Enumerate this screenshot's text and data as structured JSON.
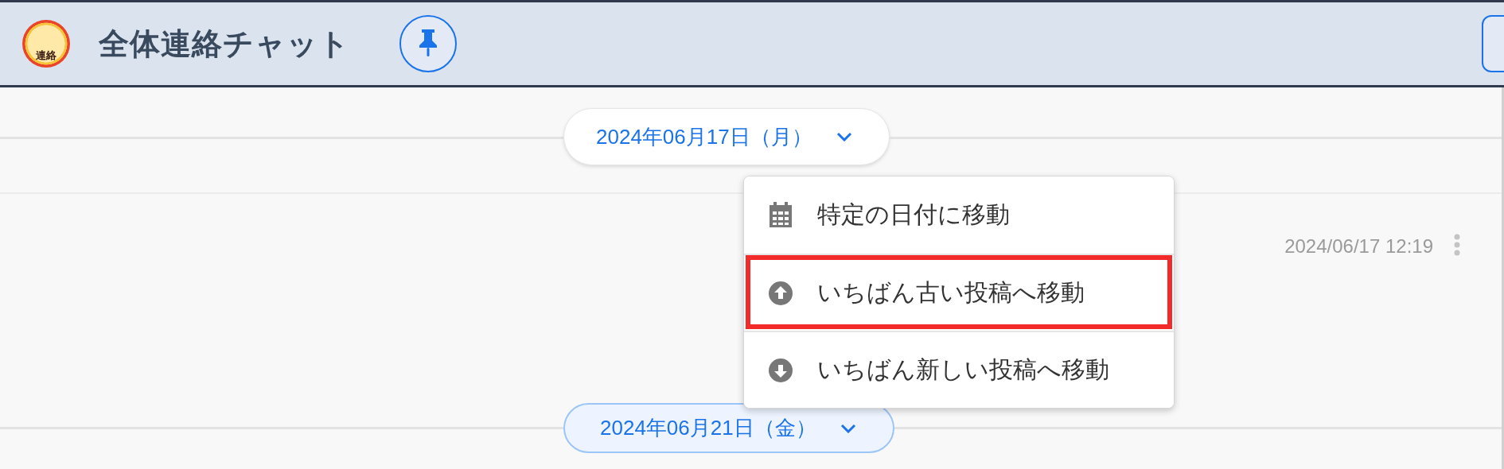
{
  "header": {
    "logo_text": "連絡",
    "title": "全体連絡チャット"
  },
  "date_dividers": [
    {
      "label": "2024年06月17日（月）",
      "highlighted": false
    },
    {
      "label": "2024年06月21日（金）",
      "highlighted": true
    }
  ],
  "message": {
    "timestamp": "2024/06/17 12:19"
  },
  "menu": {
    "items": [
      {
        "kind": "calendar",
        "label": "特定の日付に移動",
        "selected": false
      },
      {
        "kind": "up",
        "label": "いちばん古い投稿へ移動",
        "selected": true
      },
      {
        "kind": "down",
        "label": "いちばん新しい投稿へ移動",
        "selected": false
      }
    ]
  }
}
